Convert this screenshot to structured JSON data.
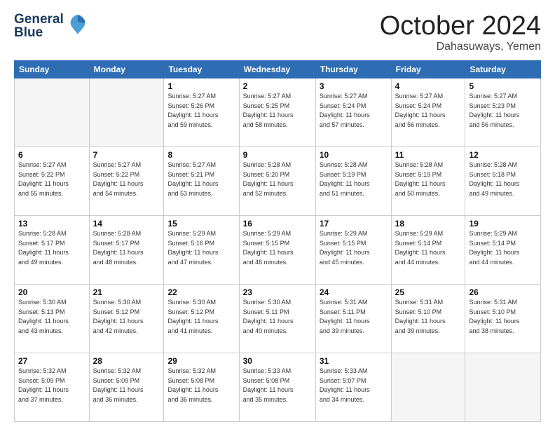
{
  "header": {
    "logo_line1": "General",
    "logo_line2": "Blue",
    "month": "October 2024",
    "location": "Dahasuways, Yemen"
  },
  "weekdays": [
    "Sunday",
    "Monday",
    "Tuesday",
    "Wednesday",
    "Thursday",
    "Friday",
    "Saturday"
  ],
  "weeks": [
    [
      {
        "day": "",
        "info": ""
      },
      {
        "day": "",
        "info": ""
      },
      {
        "day": "1",
        "info": "Sunrise: 5:27 AM\nSunset: 5:26 PM\nDaylight: 11 hours\nand 59 minutes."
      },
      {
        "day": "2",
        "info": "Sunrise: 5:27 AM\nSunset: 5:25 PM\nDaylight: 11 hours\nand 58 minutes."
      },
      {
        "day": "3",
        "info": "Sunrise: 5:27 AM\nSunset: 5:24 PM\nDaylight: 11 hours\nand 57 minutes."
      },
      {
        "day": "4",
        "info": "Sunrise: 5:27 AM\nSunset: 5:24 PM\nDaylight: 11 hours\nand 56 minutes."
      },
      {
        "day": "5",
        "info": "Sunrise: 5:27 AM\nSunset: 5:23 PM\nDaylight: 11 hours\nand 56 minutes."
      }
    ],
    [
      {
        "day": "6",
        "info": "Sunrise: 5:27 AM\nSunset: 5:22 PM\nDaylight: 11 hours\nand 55 minutes."
      },
      {
        "day": "7",
        "info": "Sunrise: 5:27 AM\nSunset: 5:22 PM\nDaylight: 11 hours\nand 54 minutes."
      },
      {
        "day": "8",
        "info": "Sunrise: 5:27 AM\nSunset: 5:21 PM\nDaylight: 11 hours\nand 53 minutes."
      },
      {
        "day": "9",
        "info": "Sunrise: 5:28 AM\nSunset: 5:20 PM\nDaylight: 11 hours\nand 52 minutes."
      },
      {
        "day": "10",
        "info": "Sunrise: 5:28 AM\nSunset: 5:19 PM\nDaylight: 11 hours\nand 51 minutes."
      },
      {
        "day": "11",
        "info": "Sunrise: 5:28 AM\nSunset: 5:19 PM\nDaylight: 11 hours\nand 50 minutes."
      },
      {
        "day": "12",
        "info": "Sunrise: 5:28 AM\nSunset: 5:18 PM\nDaylight: 11 hours\nand 49 minutes."
      }
    ],
    [
      {
        "day": "13",
        "info": "Sunrise: 5:28 AM\nSunset: 5:17 PM\nDaylight: 11 hours\nand 49 minutes."
      },
      {
        "day": "14",
        "info": "Sunrise: 5:28 AM\nSunset: 5:17 PM\nDaylight: 11 hours\nand 48 minutes."
      },
      {
        "day": "15",
        "info": "Sunrise: 5:29 AM\nSunset: 5:16 PM\nDaylight: 11 hours\nand 47 minutes."
      },
      {
        "day": "16",
        "info": "Sunrise: 5:29 AM\nSunset: 5:15 PM\nDaylight: 11 hours\nand 46 minutes."
      },
      {
        "day": "17",
        "info": "Sunrise: 5:29 AM\nSunset: 5:15 PM\nDaylight: 11 hours\nand 45 minutes."
      },
      {
        "day": "18",
        "info": "Sunrise: 5:29 AM\nSunset: 5:14 PM\nDaylight: 11 hours\nand 44 minutes."
      },
      {
        "day": "19",
        "info": "Sunrise: 5:29 AM\nSunset: 5:14 PM\nDaylight: 11 hours\nand 44 minutes."
      }
    ],
    [
      {
        "day": "20",
        "info": "Sunrise: 5:30 AM\nSunset: 5:13 PM\nDaylight: 11 hours\nand 43 minutes."
      },
      {
        "day": "21",
        "info": "Sunrise: 5:30 AM\nSunset: 5:12 PM\nDaylight: 11 hours\nand 42 minutes."
      },
      {
        "day": "22",
        "info": "Sunrise: 5:30 AM\nSunset: 5:12 PM\nDaylight: 11 hours\nand 41 minutes."
      },
      {
        "day": "23",
        "info": "Sunrise: 5:30 AM\nSunset: 5:11 PM\nDaylight: 11 hours\nand 40 minutes."
      },
      {
        "day": "24",
        "info": "Sunrise: 5:31 AM\nSunset: 5:11 PM\nDaylight: 11 hours\nand 39 minutes."
      },
      {
        "day": "25",
        "info": "Sunrise: 5:31 AM\nSunset: 5:10 PM\nDaylight: 11 hours\nand 39 minutes."
      },
      {
        "day": "26",
        "info": "Sunrise: 5:31 AM\nSunset: 5:10 PM\nDaylight: 11 hours\nand 38 minutes."
      }
    ],
    [
      {
        "day": "27",
        "info": "Sunrise: 5:32 AM\nSunset: 5:09 PM\nDaylight: 11 hours\nand 37 minutes."
      },
      {
        "day": "28",
        "info": "Sunrise: 5:32 AM\nSunset: 5:09 PM\nDaylight: 11 hours\nand 36 minutes."
      },
      {
        "day": "29",
        "info": "Sunrise: 5:32 AM\nSunset: 5:08 PM\nDaylight: 11 hours\nand 36 minutes."
      },
      {
        "day": "30",
        "info": "Sunrise: 5:33 AM\nSunset: 5:08 PM\nDaylight: 11 hours\nand 35 minutes."
      },
      {
        "day": "31",
        "info": "Sunrise: 5:33 AM\nSunset: 5:07 PM\nDaylight: 11 hours\nand 34 minutes."
      },
      {
        "day": "",
        "info": ""
      },
      {
        "day": "",
        "info": ""
      }
    ]
  ]
}
